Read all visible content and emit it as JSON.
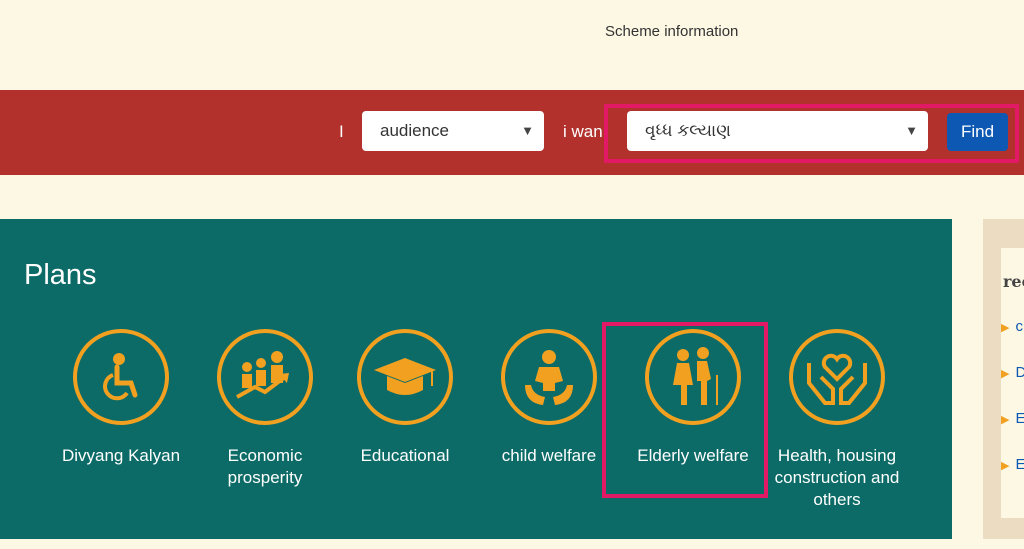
{
  "header": {
    "scheme_info_link": "Scheme information"
  },
  "filter": {
    "i_label": "I",
    "audience_value": "audience",
    "want_label": "i wan",
    "want_value": "વૃધ્ધ કલ્યાણ",
    "find_label": "Find"
  },
  "plans": {
    "title": "Plans",
    "items": [
      {
        "label": "Divyang Kalyan",
        "icon": "wheelchair-icon"
      },
      {
        "label": "Economic prosperity",
        "icon": "growth-people-icon"
      },
      {
        "label": "Educational",
        "icon": "graduation-cap-icon"
      },
      {
        "label": "child welfare",
        "icon": "child-hands-icon"
      },
      {
        "label": "Elderly welfare",
        "icon": "elderly-couple-icon"
      },
      {
        "label": "Health, housing construction and others",
        "icon": "heart-hands-icon"
      }
    ]
  },
  "sidebar": {
    "heading": "rec",
    "items": [
      "c",
      "D",
      "E",
      "E"
    ]
  },
  "colors": {
    "accent_orange": "#f1a020",
    "filter_bar": "#b2312d",
    "plans_bg": "#0c6b67",
    "find_button": "#0d58b3",
    "highlight": "#e21964"
  }
}
